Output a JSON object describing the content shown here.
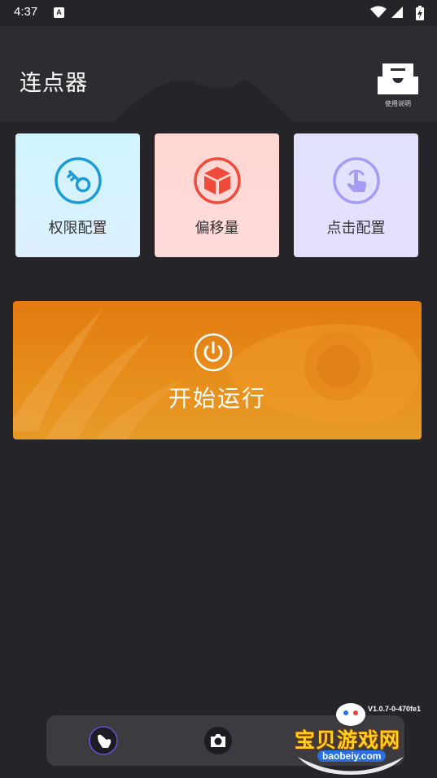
{
  "status_bar": {
    "time": "4:37",
    "notification_badge": "A",
    "icons": [
      "wifi-icon",
      "signal-icon",
      "battery-charging-icon"
    ]
  },
  "header": {
    "title": "连点器",
    "manual_label": "使用说明",
    "manual_icon": "inbox-icon"
  },
  "cards": [
    {
      "label": "权限配置",
      "icon": "key-icon",
      "color": "#1d9bd6"
    },
    {
      "label": "偏移量",
      "icon": "cube-icon",
      "color": "#f04a3a"
    },
    {
      "label": "点击配置",
      "icon": "tap-icon",
      "color": "#a59cf6"
    }
  ],
  "start": {
    "label": "开始运行",
    "icon": "power-icon",
    "color": "#e27a10"
  },
  "version": "V1.0.7-0-470fe1",
  "bottom_bar": {
    "icons": [
      "pointer-icon",
      "camera-icon"
    ]
  },
  "watermark": {
    "text": "宝贝游戏网",
    "sub": "baobeiy.com"
  },
  "colors": {
    "background": "#252429",
    "header": "#2d2c30",
    "bottom_bar": "#3c3b40"
  }
}
